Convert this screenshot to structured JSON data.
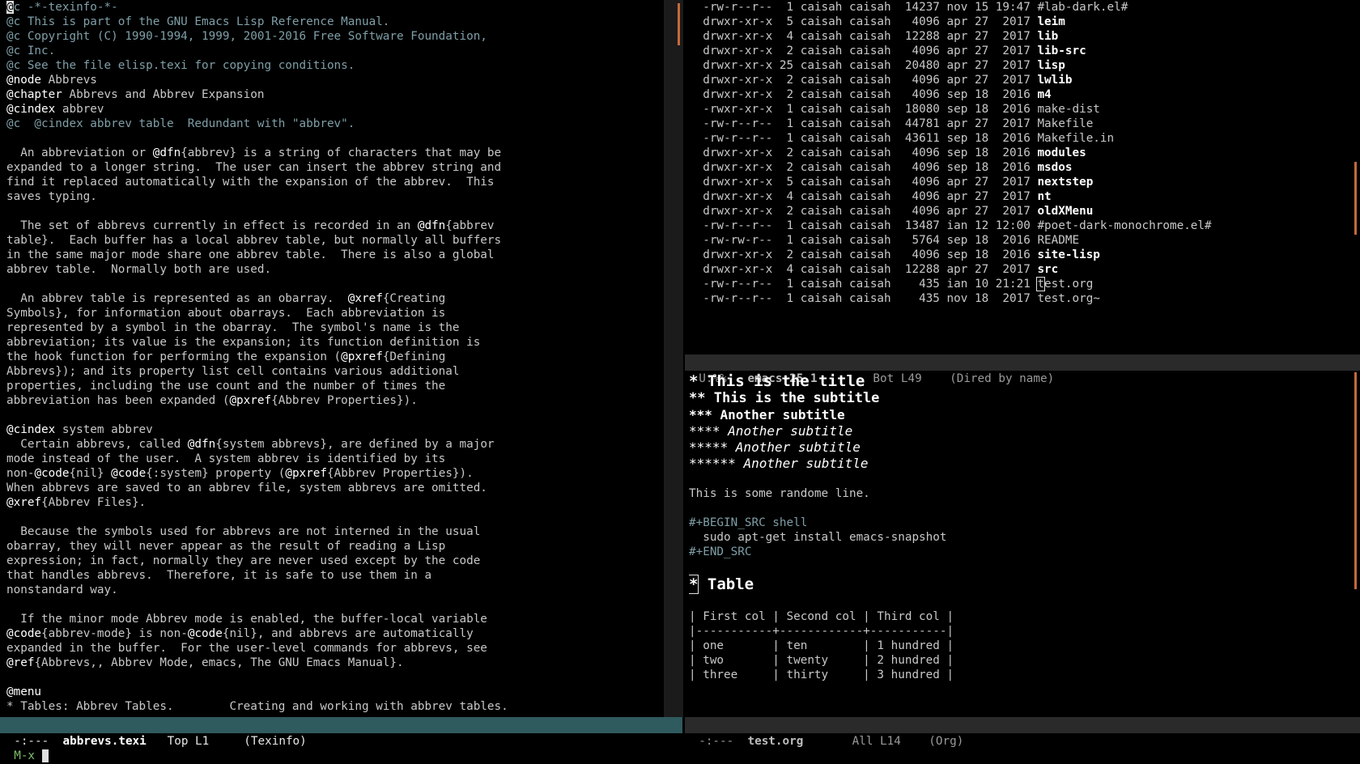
{
  "left": {
    "lines": [
      [
        {
          "t": "@",
          "c": "cursor"
        },
        {
          "t": "c -*-texinfo-*-",
          "c": "c-comment"
        }
      ],
      [
        {
          "t": "@c This is part of the GNU Emacs Lisp Reference Manual.",
          "c": "c-comment"
        }
      ],
      [
        {
          "t": "@c Copyright (C) 1990-1994, 1999, 2001-2016 Free Software Foundation,",
          "c": "c-comment"
        }
      ],
      [
        {
          "t": "@c Inc.",
          "c": "c-comment"
        }
      ],
      [
        {
          "t": "@c See the file elisp.texi for copying conditions.",
          "c": "c-comment"
        }
      ],
      [
        {
          "t": "@node",
          "c": "c-key"
        },
        {
          "t": " Abbrevs",
          "c": ""
        }
      ],
      [
        {
          "t": "@chapter",
          "c": "c-key"
        },
        {
          "t": " Abbrevs and Abbrev Expansion",
          "c": ""
        }
      ],
      [
        {
          "t": "@cindex",
          "c": "c-key"
        },
        {
          "t": " abbrev",
          "c": ""
        }
      ],
      [
        {
          "t": "@c  @cindex abbrev table  Redundant with \"abbrev\".",
          "c": "c-comment"
        }
      ],
      [
        {
          "t": "",
          "c": ""
        }
      ],
      [
        {
          "t": "  An abbreviation or ",
          "c": ""
        },
        {
          "t": "@dfn",
          "c": "c-key"
        },
        {
          "t": "{abbrev} is a string of characters that may be",
          "c": ""
        }
      ],
      [
        {
          "t": "expanded to a longer string.  The user can insert the abbrev string and",
          "c": ""
        }
      ],
      [
        {
          "t": "find it replaced automatically with the expansion of the abbrev.  This",
          "c": ""
        }
      ],
      [
        {
          "t": "saves typing.",
          "c": ""
        }
      ],
      [
        {
          "t": "",
          "c": ""
        }
      ],
      [
        {
          "t": "  The set of abbrevs currently in effect is recorded in an ",
          "c": ""
        },
        {
          "t": "@dfn",
          "c": "c-key"
        },
        {
          "t": "{abbrev",
          "c": ""
        }
      ],
      [
        {
          "t": "table}.  Each buffer has a local abbrev table, but normally all buffers",
          "c": ""
        }
      ],
      [
        {
          "t": "in the same major mode share one abbrev table.  There is also a global",
          "c": ""
        }
      ],
      [
        {
          "t": "abbrev table.  Normally both are used.",
          "c": ""
        }
      ],
      [
        {
          "t": "",
          "c": ""
        }
      ],
      [
        {
          "t": "  An abbrev table is represented as an obarray.  ",
          "c": ""
        },
        {
          "t": "@xref",
          "c": "c-key"
        },
        {
          "t": "{Creating",
          "c": ""
        }
      ],
      [
        {
          "t": "Symbols}, for information about obarrays.  Each abbreviation is",
          "c": ""
        }
      ],
      [
        {
          "t": "represented by a symbol in the obarray.  The symbol's name is the",
          "c": ""
        }
      ],
      [
        {
          "t": "abbreviation; its value is the expansion; its function definition is",
          "c": ""
        }
      ],
      [
        {
          "t": "the hook function for performing the expansion (",
          "c": ""
        },
        {
          "t": "@pxref",
          "c": "c-key"
        },
        {
          "t": "{Defining",
          "c": ""
        }
      ],
      [
        {
          "t": "Abbrevs}); and its property list cell contains various additional",
          "c": ""
        }
      ],
      [
        {
          "t": "properties, including the use count and the number of times the",
          "c": ""
        }
      ],
      [
        {
          "t": "abbreviation has been expanded (",
          "c": ""
        },
        {
          "t": "@pxref",
          "c": "c-key"
        },
        {
          "t": "{Abbrev Properties}).",
          "c": ""
        }
      ],
      [
        {
          "t": "",
          "c": ""
        }
      ],
      [
        {
          "t": "@cindex",
          "c": "c-key"
        },
        {
          "t": " system abbrev",
          "c": ""
        }
      ],
      [
        {
          "t": "  Certain abbrevs, called ",
          "c": ""
        },
        {
          "t": "@dfn",
          "c": "c-key"
        },
        {
          "t": "{system abbrevs}, are defined by a major",
          "c": ""
        }
      ],
      [
        {
          "t": "mode instead of the user.  A system abbrev is identified by its",
          "c": ""
        }
      ],
      [
        {
          "t": "non-",
          "c": ""
        },
        {
          "t": "@code",
          "c": "c-key"
        },
        {
          "t": "{nil} ",
          "c": ""
        },
        {
          "t": "@code",
          "c": "c-key"
        },
        {
          "t": "{:system} property (",
          "c": ""
        },
        {
          "t": "@pxref",
          "c": "c-key"
        },
        {
          "t": "{Abbrev Properties}).",
          "c": ""
        }
      ],
      [
        {
          "t": "When abbrevs are saved to an abbrev file, system abbrevs are omitted.",
          "c": ""
        }
      ],
      [
        {
          "t": "@xref",
          "c": "c-key"
        },
        {
          "t": "{Abbrev Files}.",
          "c": ""
        }
      ],
      [
        {
          "t": "",
          "c": ""
        }
      ],
      [
        {
          "t": "  Because the symbols used for abbrevs are not interned in the usual",
          "c": ""
        }
      ],
      [
        {
          "t": "obarray, they will never appear as the result of reading a Lisp",
          "c": ""
        }
      ],
      [
        {
          "t": "expression; in fact, normally they are never used except by the code",
          "c": ""
        }
      ],
      [
        {
          "t": "that handles abbrevs.  Therefore, it is safe to use them in a",
          "c": ""
        }
      ],
      [
        {
          "t": "nonstandard way.",
          "c": ""
        }
      ],
      [
        {
          "t": "",
          "c": ""
        }
      ],
      [
        {
          "t": "  If the minor mode Abbrev mode is enabled, the buffer-local variable",
          "c": ""
        }
      ],
      [
        {
          "t": "@code",
          "c": "c-key"
        },
        {
          "t": "{abbrev-mode} is non-",
          "c": ""
        },
        {
          "t": "@code",
          "c": "c-key"
        },
        {
          "t": "{nil}, and abbrevs are automatically",
          "c": ""
        }
      ],
      [
        {
          "t": "expanded in the buffer.  For the user-level commands for abbrevs, see",
          "c": ""
        }
      ],
      [
        {
          "t": "@ref",
          "c": "c-key"
        },
        {
          "t": "{Abbrevs,, Abbrev Mode, emacs, The GNU Emacs Manual}.",
          "c": ""
        }
      ],
      [
        {
          "t": "",
          "c": ""
        }
      ],
      [
        {
          "t": "@menu",
          "c": "c-key"
        }
      ],
      [
        {
          "t": "* Tables: Abbrev Tables.        Creating and working with abbrev tables.",
          "c": ""
        }
      ]
    ],
    "modeline": {
      "state": "-:---  ",
      "buffer": "abbrevs.texi",
      "pos": "   Top L1     ",
      "mode": "(Texinfo)"
    }
  },
  "dired": {
    "rows": [
      {
        "perm": "-rw-r--r--",
        "n": " 1",
        "o": "caisah",
        "g": "caisah",
        "size": "14237",
        "date": "nov 15 19:47",
        "name": "#lab-dark.el#",
        "dir": false
      },
      {
        "perm": "drwxr-xr-x",
        "n": " 5",
        "o": "caisah",
        "g": "caisah",
        "size": "4096",
        "date": "apr 27  2017",
        "name": "leim",
        "dir": true
      },
      {
        "perm": "drwxr-xr-x",
        "n": " 4",
        "o": "caisah",
        "g": "caisah",
        "size": "12288",
        "date": "apr 27  2017",
        "name": "lib",
        "dir": true
      },
      {
        "perm": "drwxr-xr-x",
        "n": " 2",
        "o": "caisah",
        "g": "caisah",
        "size": "4096",
        "date": "apr 27  2017",
        "name": "lib-src",
        "dir": true
      },
      {
        "perm": "drwxr-xr-x",
        "n": "25",
        "o": "caisah",
        "g": "caisah",
        "size": "20480",
        "date": "apr 27  2017",
        "name": "lisp",
        "dir": true
      },
      {
        "perm": "drwxr-xr-x",
        "n": " 2",
        "o": "caisah",
        "g": "caisah",
        "size": "4096",
        "date": "apr 27  2017",
        "name": "lwlib",
        "dir": true
      },
      {
        "perm": "drwxr-xr-x",
        "n": " 2",
        "o": "caisah",
        "g": "caisah",
        "size": "4096",
        "date": "sep 18  2016",
        "name": "m4",
        "dir": true
      },
      {
        "perm": "-rwxr-xr-x",
        "n": " 1",
        "o": "caisah",
        "g": "caisah",
        "size": "18080",
        "date": "sep 18  2016",
        "name": "make-dist",
        "dir": false
      },
      {
        "perm": "-rw-r--r--",
        "n": " 1",
        "o": "caisah",
        "g": "caisah",
        "size": "44781",
        "date": "apr 27  2017",
        "name": "Makefile",
        "dir": false
      },
      {
        "perm": "-rw-r--r--",
        "n": " 1",
        "o": "caisah",
        "g": "caisah",
        "size": "43611",
        "date": "sep 18  2016",
        "name": "Makefile.in",
        "dir": false
      },
      {
        "perm": "drwxr-xr-x",
        "n": " 2",
        "o": "caisah",
        "g": "caisah",
        "size": "4096",
        "date": "sep 18  2016",
        "name": "modules",
        "dir": true
      },
      {
        "perm": "drwxr-xr-x",
        "n": " 2",
        "o": "caisah",
        "g": "caisah",
        "size": "4096",
        "date": "sep 18  2016",
        "name": "msdos",
        "dir": true
      },
      {
        "perm": "drwxr-xr-x",
        "n": " 5",
        "o": "caisah",
        "g": "caisah",
        "size": "4096",
        "date": "apr 27  2017",
        "name": "nextstep",
        "dir": true
      },
      {
        "perm": "drwxr-xr-x",
        "n": " 4",
        "o": "caisah",
        "g": "caisah",
        "size": "4096",
        "date": "apr 27  2017",
        "name": "nt",
        "dir": true
      },
      {
        "perm": "drwxr-xr-x",
        "n": " 2",
        "o": "caisah",
        "g": "caisah",
        "size": "4096",
        "date": "apr 27  2017",
        "name": "oldXMenu",
        "dir": true
      },
      {
        "perm": "-rw-r--r--",
        "n": " 1",
        "o": "caisah",
        "g": "caisah",
        "size": "13487",
        "date": "ian 12 12:00",
        "name": "#poet-dark-monochrome.el#",
        "dir": false
      },
      {
        "perm": "-rw-rw-r--",
        "n": " 1",
        "o": "caisah",
        "g": "caisah",
        "size": "5764",
        "date": "sep 18  2016",
        "name": "README",
        "dir": false
      },
      {
        "perm": "drwxr-xr-x",
        "n": " 2",
        "o": "caisah",
        "g": "caisah",
        "size": "4096",
        "date": "sep 18  2016",
        "name": "site-lisp",
        "dir": true
      },
      {
        "perm": "drwxr-xr-x",
        "n": " 4",
        "o": "caisah",
        "g": "caisah",
        "size": "12288",
        "date": "apr 27  2017",
        "name": "src",
        "dir": true
      },
      {
        "perm": "-rw-r--r--",
        "n": " 1",
        "o": "caisah",
        "g": "caisah",
        "size": "435",
        "date": "ian 10 21:21",
        "name": "test.org",
        "dir": false,
        "cursor": true
      },
      {
        "perm": "-rw-r--r--",
        "n": " 1",
        "o": "caisah",
        "g": "caisah",
        "size": "435",
        "date": "nov 18  2017",
        "name": "test.org~",
        "dir": false
      }
    ],
    "modeline": {
      "state": "U:%%-  ",
      "buffer": "emacs-25.1",
      "pos": "        Bot L49    ",
      "mode": "(Dired by name)"
    }
  },
  "org": {
    "headings": [
      {
        "stars": "* ",
        "text": "This is the title",
        "style": "h1"
      },
      {
        "stars": "** ",
        "text": "This is the subtitle",
        "style": "h2"
      },
      {
        "stars": "*** ",
        "text": "Another subtitle",
        "style": "h3"
      },
      {
        "stars": "**** ",
        "text": "Another subtitle",
        "style": "h4"
      },
      {
        "stars": "***** ",
        "text": "Another subtitle",
        "style": "h4"
      },
      {
        "stars": "****** ",
        "text": "Another subtitle",
        "style": "h4"
      }
    ],
    "body_line": "This is some randome line.",
    "src_begin": "#+BEGIN_SRC shell",
    "src_code": "  sudo apt-get install emacs-snapshot",
    "src_end": "#+END_SRC",
    "table_heading_star": "*",
    "table_heading_text": " Table",
    "table_lines": [
      "| First col | Second col | Third col |",
      "|-----------+------------+-----------|",
      "| one       | ten        | 1 hundred |",
      "| two       | twenty     | 2 hundred |",
      "| three     | thirty     | 3 hundred |"
    ],
    "modeline": {
      "state": "-:---  ",
      "buffer": "test.org",
      "pos": "       All L14    ",
      "mode": "(Org)"
    }
  },
  "minibuffer": {
    "prompt": "M-x ",
    "input": ""
  },
  "colors": {
    "active_modeline": "#2f5a5e",
    "inactive_modeline": "#2a2a2a",
    "comment": "#7f9fa8",
    "fringe_mark": "#c46a3a"
  }
}
